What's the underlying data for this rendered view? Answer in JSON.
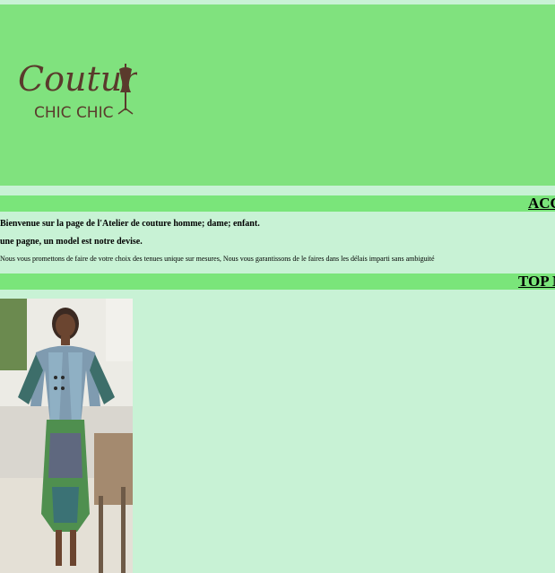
{
  "header": {
    "logo": {
      "line1": "Couture",
      "line2": "CHIC CHIC",
      "icon": "dress-form-icon",
      "color": "#5a3a2c"
    },
    "background": "#80e27e"
  },
  "sections": {
    "accueil_title": "ACC",
    "top_title": "TOP M"
  },
  "intro": {
    "welcome": "Bienvenue sur la page de l'Atelier de couture homme; dame; enfant.",
    "motto": "une pagne, un model est notre devise.",
    "promise": "Nous vous promettons de faire de votre choix des tenues unique sur mesures, Nous vous garantissons de le faires dans les délais imparti sans ambiguité"
  },
  "colors": {
    "page_bg": "#c8f2d5",
    "bar_bg": "#7ae57a"
  }
}
